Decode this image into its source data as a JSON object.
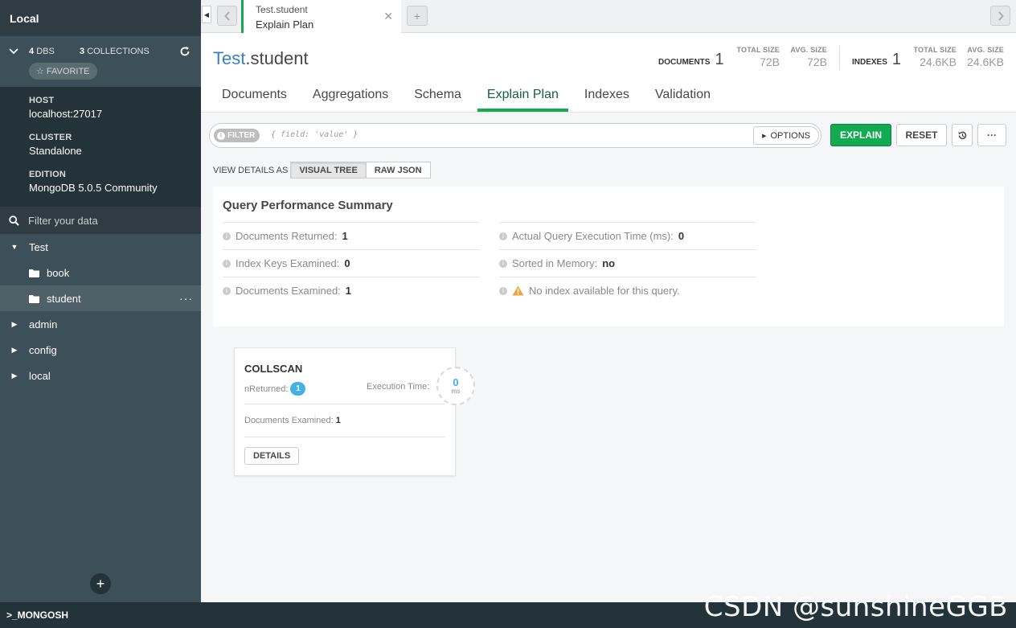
{
  "sidebar": {
    "title": "Local",
    "dbs_count": "4",
    "dbs_label": "DBS",
    "collections_count": "3",
    "collections_label": "COLLECTIONS",
    "favorite_label": "☆ FAVORITE",
    "host_label": "HOST",
    "host_value": "localhost:27017",
    "cluster_label": "CLUSTER",
    "cluster_value": "Standalone",
    "edition_label": "EDITION",
    "edition_value": "MongoDB 5.0.5 Community",
    "filter_placeholder": "Filter your data",
    "tree": [
      {
        "label": "Test",
        "expanded": true
      },
      {
        "label": "book",
        "collection": true
      },
      {
        "label": "student",
        "collection": true,
        "active": true
      },
      {
        "label": "admin"
      },
      {
        "label": "config"
      },
      {
        "label": "local"
      }
    ],
    "add_label": "+"
  },
  "tabbar": {
    "tab_namespace": "Test.student",
    "tab_view": "Explain Plan",
    "close_glyph": "✕",
    "new_tab_glyph": "+"
  },
  "header": {
    "db": "Test",
    "collection": ".student",
    "documents_label": "DOCUMENTS",
    "documents_value": "1",
    "total_size_label": "TOTAL SIZE",
    "total_size_value": "72B",
    "avg_size_label": "AVG. SIZE",
    "avg_size_value": "72B",
    "indexes_label": "INDEXES",
    "indexes_value": "1",
    "idx_total_size_label": "TOTAL SIZE",
    "idx_total_size_value": "24.6KB",
    "idx_avg_size_label": "AVG. SIZE",
    "idx_avg_size_value": "24.6KB"
  },
  "subtabs": [
    "Documents",
    "Aggregations",
    "Schema",
    "Explain Plan",
    "Indexes",
    "Validation"
  ],
  "querybar": {
    "filter_label": "FILTER",
    "filter_placeholder": "{ field: 'value' }",
    "options_label": "OPTIONS",
    "explain_label": "EXPLAIN",
    "reset_label": "RESET",
    "more_label": "···"
  },
  "view_details": {
    "label": "VIEW DETAILS AS",
    "visual_tree": "VISUAL TREE",
    "raw_json": "RAW JSON"
  },
  "summary": {
    "title": "Query Performance Summary",
    "docs_returned_label": "Documents Returned:",
    "docs_returned_value": "1",
    "index_keys_label": "Index Keys Examined:",
    "index_keys_value": "0",
    "docs_examined_label": "Documents Examined:",
    "docs_examined_value": "1",
    "exec_time_label": "Actual Query Execution Time (ms):",
    "exec_time_value": "0",
    "sorted_label": "Sorted in Memory:",
    "sorted_value": "no",
    "no_index_text": "No index available for this query."
  },
  "stage": {
    "name": "COLLSCAN",
    "nreturned_label": "nReturned:",
    "nreturned_value": "1",
    "exec_time_label": "Execution Time:",
    "exec_time_value": "0",
    "exec_time_unit": "ms",
    "docs_examined_label": "Documents Examined:",
    "docs_examined_value": "1",
    "details_label": "DETAILS"
  },
  "footer": {
    "mongosh_label": ">_MONGOSH",
    "watermark": "CSDN @sunshineGGB"
  },
  "colors": {
    "accent_green": "#13aa52",
    "sidebar_bg": "#3d4f58",
    "sidebar_dark": "#243239",
    "link_blue": "#3a7fc1",
    "badge_blue": "#43b1e5"
  }
}
